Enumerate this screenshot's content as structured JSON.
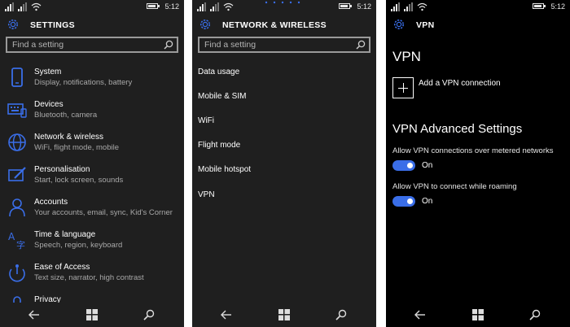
{
  "status": {
    "time": "5:12"
  },
  "colors": {
    "accent": "#3a6ee8",
    "background": "#1f1f1f",
    "vpn_background": "#000000"
  },
  "settings": {
    "title": "SETTINGS",
    "search_placeholder": "Find a setting",
    "categories": [
      {
        "title": "System",
        "subtitle": "Display, notifications, battery",
        "icon": "phone-icon"
      },
      {
        "title": "Devices",
        "subtitle": "Bluetooth, camera",
        "icon": "keyboard-icon"
      },
      {
        "title": "Network & wireless",
        "subtitle": "WiFi, flight mode, mobile",
        "icon": "globe-icon"
      },
      {
        "title": "Personalisation",
        "subtitle": "Start, lock screen, sounds",
        "icon": "paintbrush-icon"
      },
      {
        "title": "Accounts",
        "subtitle": "Your accounts, email, sync, Kid's Corner",
        "icon": "person-icon"
      },
      {
        "title": "Time & language",
        "subtitle": "Speech, region, keyboard",
        "icon": "language-icon"
      },
      {
        "title": "Ease of Access",
        "subtitle": "Text size, narrator, high contrast",
        "icon": "ease-of-access-icon"
      },
      {
        "title": "Privacy",
        "subtitle": "",
        "icon": "lock-icon"
      }
    ]
  },
  "network": {
    "title": "NETWORK & WIRELESS",
    "search_placeholder": "Find a setting",
    "items": [
      "Data usage",
      "Mobile & SIM",
      "WiFi",
      "Flight mode",
      "Mobile hotspot",
      "VPN"
    ]
  },
  "vpn": {
    "title": "VPN",
    "heading": "VPN",
    "add_label": "Add a VPN connection",
    "advanced_heading": "VPN Advanced Settings",
    "settings": [
      {
        "label": "Allow VPN connections over metered networks",
        "state": "On",
        "on": true
      },
      {
        "label": "Allow VPN to connect while roaming",
        "state": "On",
        "on": true
      }
    ]
  }
}
